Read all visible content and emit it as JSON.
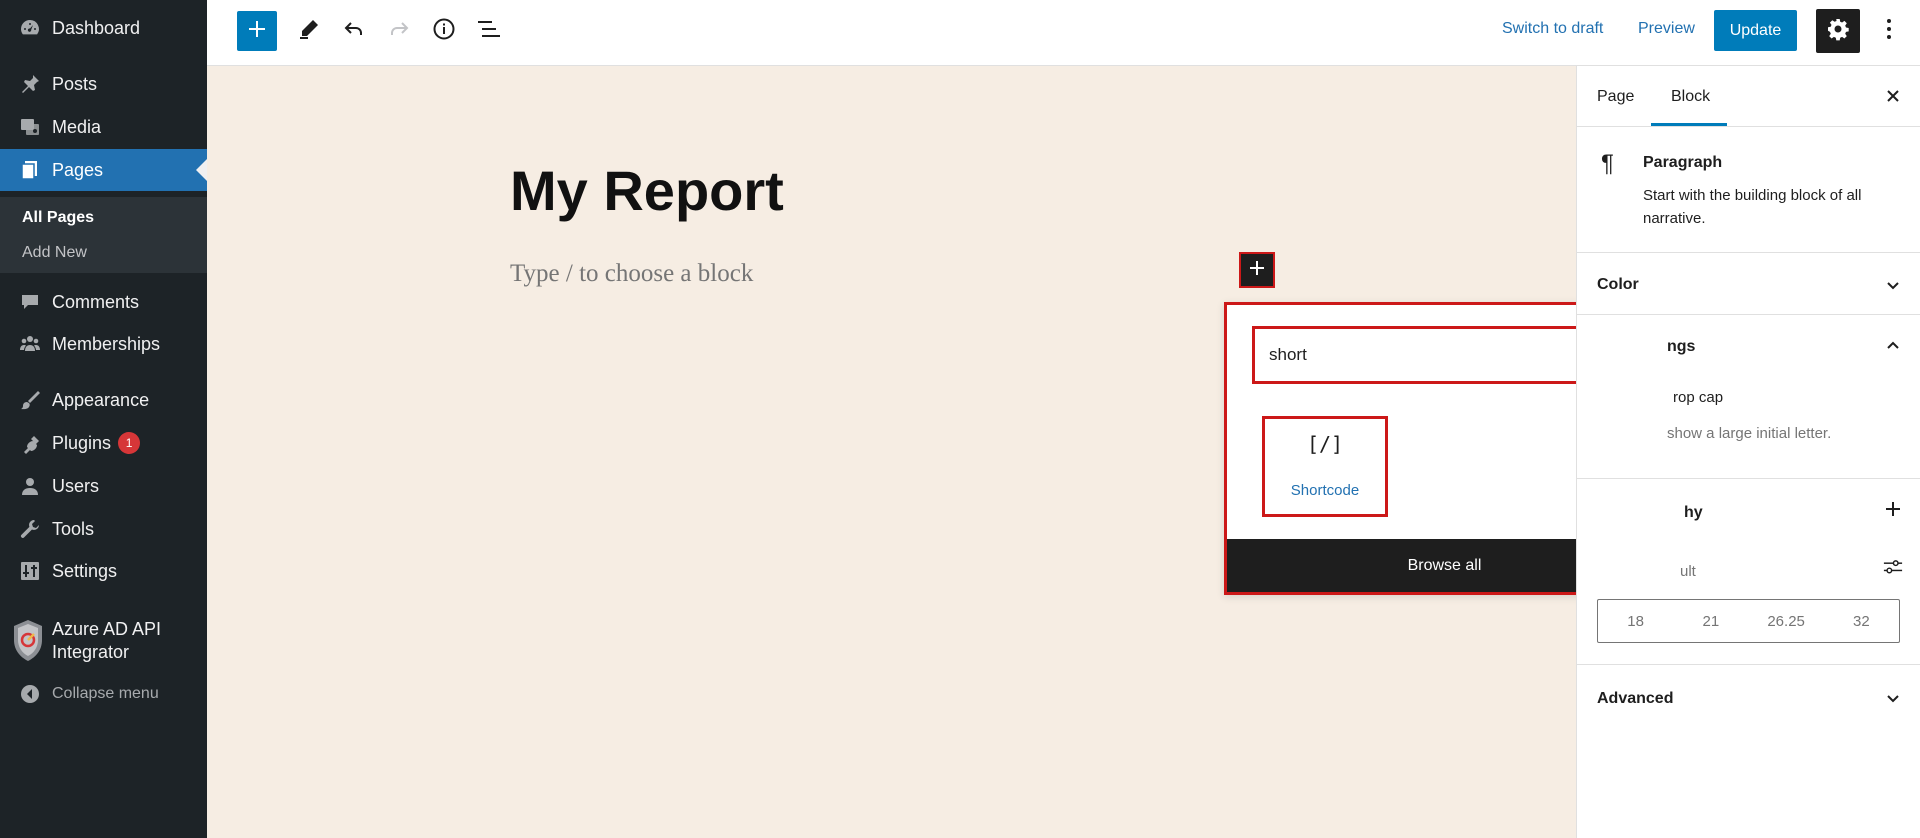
{
  "admin_menu": {
    "items": [
      {
        "label": "Dashboard",
        "icon": "dashboard-icon"
      },
      {
        "label": "Posts",
        "icon": "pin-icon"
      },
      {
        "label": "Media",
        "icon": "media-icon"
      },
      {
        "label": "Pages",
        "icon": "pages-icon",
        "current": true
      },
      {
        "label": "Comments",
        "icon": "comment-icon"
      },
      {
        "label": "Memberships",
        "icon": "groups-icon"
      },
      {
        "label": "Appearance",
        "icon": "brush-icon"
      },
      {
        "label": "Plugins",
        "icon": "plugin-icon",
        "badge": "1"
      },
      {
        "label": "Users",
        "icon": "user-icon"
      },
      {
        "label": "Tools",
        "icon": "wrench-icon"
      },
      {
        "label": "Settings",
        "icon": "settings-sliders-icon"
      }
    ],
    "submenu": [
      "All Pages",
      "Add New"
    ],
    "azure_label": "Azure AD API Integrator",
    "collapse_label": "Collapse menu"
  },
  "toolbar": {
    "switch_to_draft": "Switch to draft",
    "preview": "Preview",
    "update": "Update"
  },
  "editor": {
    "title": "My Report",
    "placeholder": "Type / to choose a block"
  },
  "inserter": {
    "search_value": "short",
    "result_icon": "[/]",
    "result_label": "Shortcode",
    "browse_all": "Browse all"
  },
  "settings": {
    "tabs": [
      "Page",
      "Block"
    ],
    "active_tab": "Block",
    "block_name": "Paragraph",
    "block_description": "Start with the building block of all narrative.",
    "color_panel": "Color",
    "text_settings_partial": "ngs",
    "drop_cap_partial": "rop cap",
    "drop_cap_help_partial": "show a large initial letter.",
    "typography_partial": "hy",
    "default_partial": "ult",
    "font_sizes": [
      "18",
      "21",
      "26.25",
      "32"
    ],
    "advanced_panel": "Advanced"
  },
  "colors": {
    "admin_bg": "#1d2327",
    "admin_accent": "#2271b1",
    "wp_blue": "#007cba",
    "canvas_bg": "#f6ede3",
    "highlight_red": "#cc1818"
  }
}
